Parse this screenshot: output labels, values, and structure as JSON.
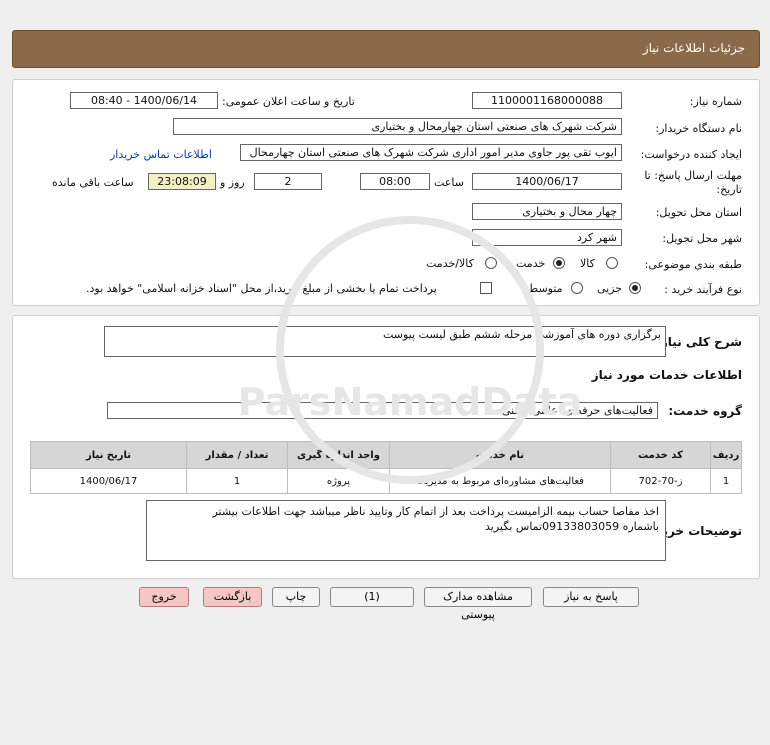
{
  "header": {
    "title": "جزئیات اطلاعات نیاز"
  },
  "form": {
    "need_number_label": "شماره نیاز:",
    "need_number": "1100001168000088",
    "announce_label": "تاریخ و ساعت اعلان عمومی:",
    "announce_value": "1400/06/14 - 08:40",
    "buyer_label": "نام دستگاه خریدار:",
    "buyer_value": "شرکت شهرک های صنعتی استان چهارمحال و بختیاری",
    "creator_label": "ایجاد کننده درخواست:",
    "creator_value": "ایوب تقی پور جاوی مدیر امور اداری شرکت شهرک های صنعتی استان چهارمحال",
    "contact_link": "اطلاعات تماس خریدار",
    "deadline_label_1": "مهلت ارسال پاسخ: تا",
    "deadline_label_2": "تاریخ:",
    "deadline_date": "1400/06/17",
    "time_label": "ساعت",
    "deadline_time": "08:00",
    "days_value": "2",
    "days_label": "روز و",
    "remaining_value": "23:08:09",
    "remaining_label": "ساعت باقی مانده",
    "province_label": "استان محل تحویل:",
    "province_value": "چهار محال و بختیاری",
    "city_label": "شهر محل تحویل:",
    "city_value": "شهر کرد",
    "category_label": "طبقه بندی موضوعی:",
    "category_options": [
      "کالا",
      "خدمت",
      "کالا/خدمت"
    ],
    "category_selected": 1,
    "process_label": "نوع فرآیند خرید :",
    "process_options": [
      "جزیی",
      "متوسط"
    ],
    "process_selected": 0,
    "process_note": "پرداخت تمام یا بخشی از مبلغ خرید،از محل \"اسناد خزانه اسلامی\" خواهد بود."
  },
  "summary": {
    "label": "شرح کلی نیاز:",
    "value": "برگزاری دوره های آموزشی مرحله ششم طبق لیست پیوست"
  },
  "services": {
    "section_title": "اطلاعات خدمات مورد نیاز",
    "group_label": "گروه خدمت:",
    "group_value": "فعالیت‌های حرفه‌ای، علمی و فنی",
    "columns": [
      "ردیف",
      "کد خدمت",
      "نام خدمت",
      "واحد اندازه گیری",
      "تعداد / مقدار",
      "تاریخ نیاز"
    ],
    "rows": [
      [
        "1",
        "ز-70-702",
        "فعالیت‌های مشاوره‌ای مربوط به مدیریت",
        "پروژه",
        "1",
        "1400/06/17"
      ]
    ]
  },
  "notes": {
    "label": "توضیحات خریدار:",
    "line1": "اخذ مفاصا حساب بیمه الزامیست پرداخت بعد از اتمام کار وتایید ناظر میباشد جهت اطلاعات بیشتر",
    "line2": "باشماره 09133803059تماس بگیرید"
  },
  "buttons": {
    "reply": "پاسخ به نیاز",
    "view_docs": "مشاهده مدارک پیوستی (1)",
    "print": "چاپ",
    "back": "بازگشت",
    "exit": "خروج"
  },
  "watermark": {
    "brand": "ParsNamadData"
  }
}
